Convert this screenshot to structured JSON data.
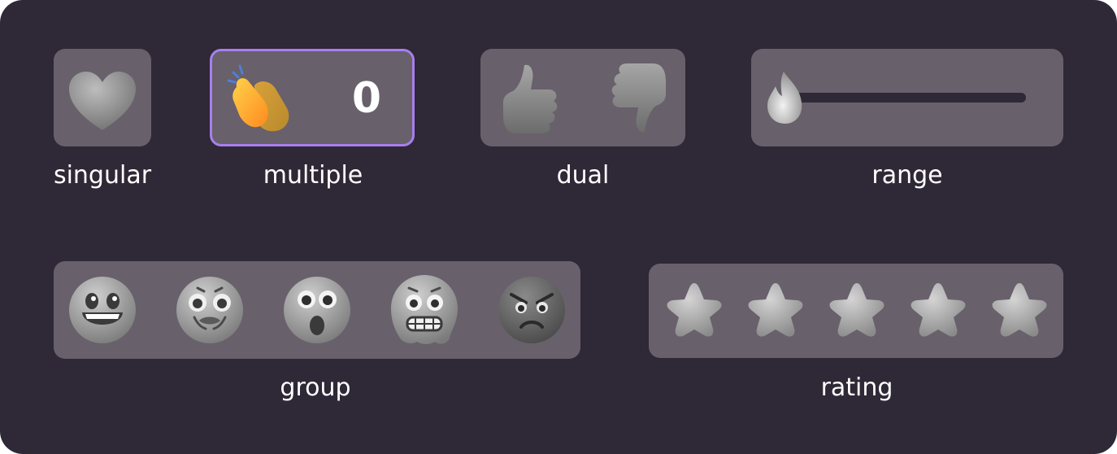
{
  "colors": {
    "panel_background": "#2f2836",
    "card_background": "#68606b",
    "active_outline": "#a77fec",
    "label_text": "#ffffff",
    "range_track": "#2f2836"
  },
  "widgets": {
    "singular": {
      "label": "singular",
      "icon": "heart-icon"
    },
    "multiple": {
      "label": "multiple",
      "icon": "clapping-hands-icon",
      "count": "0",
      "active": true
    },
    "dual": {
      "label": "dual",
      "icons": [
        "thumbs-up-icon",
        "thumbs-down-icon"
      ]
    },
    "range": {
      "label": "range",
      "icon": "fire-icon",
      "value_fraction": 0
    },
    "group": {
      "label": "group",
      "icons": [
        "grinning-face-icon",
        "nauseated-face-icon",
        "surprised-face-icon",
        "grimacing-face-icon",
        "angry-face-icon"
      ]
    },
    "rating": {
      "label": "rating",
      "max": 5,
      "value": 0,
      "icon": "star-icon"
    }
  }
}
